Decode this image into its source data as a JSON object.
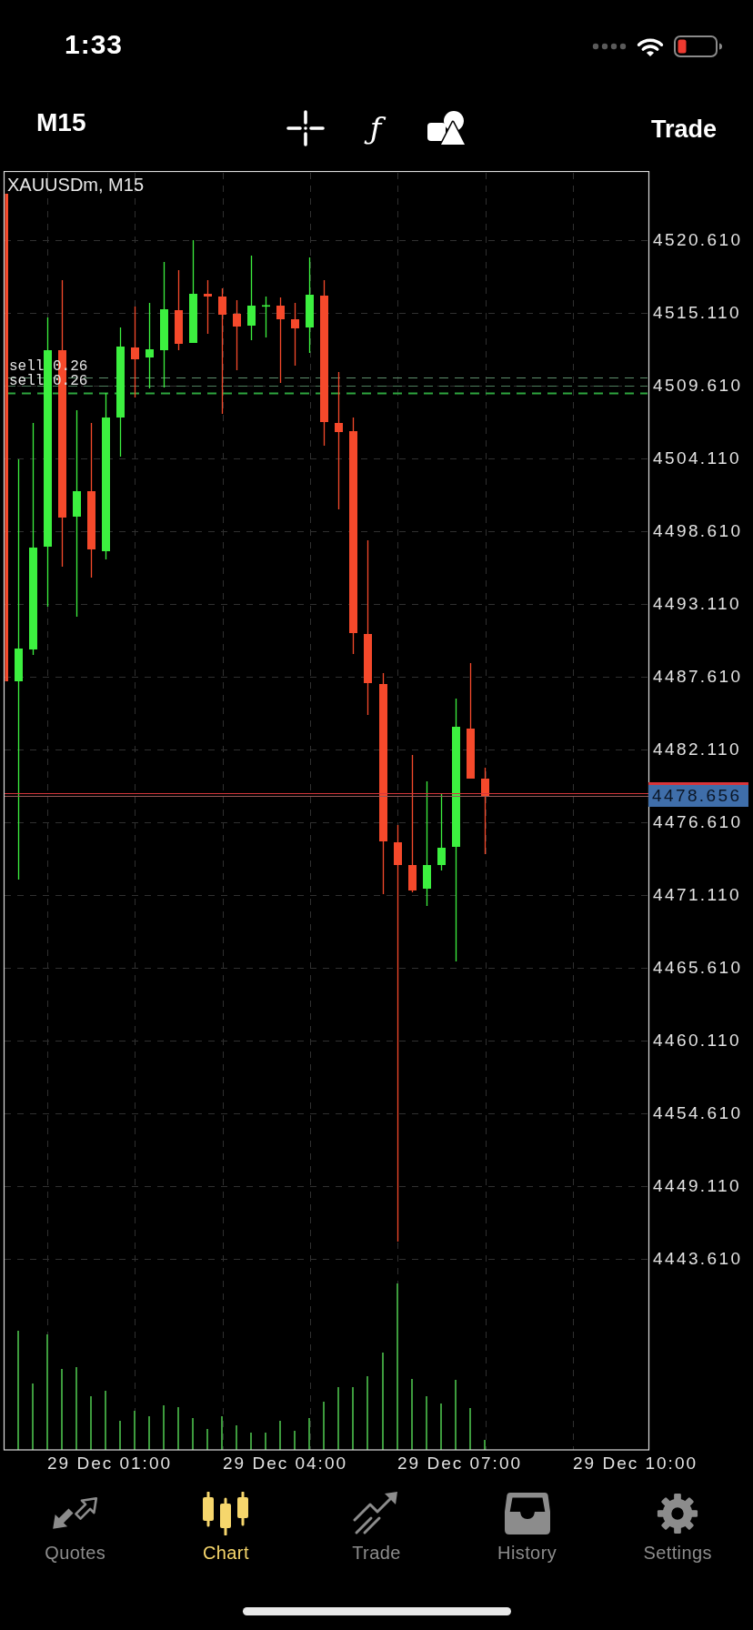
{
  "status_bar": {
    "time": "1:33"
  },
  "toolbar": {
    "timeframe": "M15",
    "function_symbol": "ƒ",
    "action": "Trade"
  },
  "chart": {
    "symbol": "XAUUSDm, M15",
    "orders": [
      {
        "label": "sell 0.26"
      },
      {
        "label": "sell 0.26"
      }
    ],
    "price_labels": [
      "4520.610",
      "4515.110",
      "4509.610",
      "4504.110",
      "4498.610",
      "4493.110",
      "4487.610",
      "4482.110",
      "4476.610",
      "4471.110",
      "4465.610",
      "4460.110",
      "4454.610",
      "4449.110",
      "4443.610"
    ],
    "current_price": "4478.656",
    "time_labels": [
      "29 Dec 01:00",
      "29 Dec 04:00",
      "29 Dec 07:00",
      "29 Dec 10:00"
    ]
  },
  "tabs": [
    {
      "label": "Quotes",
      "selected": false
    },
    {
      "label": "Chart",
      "selected": true
    },
    {
      "label": "Trade",
      "selected": false
    },
    {
      "label": "History",
      "selected": false
    },
    {
      "label": "Settings",
      "selected": false
    }
  ]
}
